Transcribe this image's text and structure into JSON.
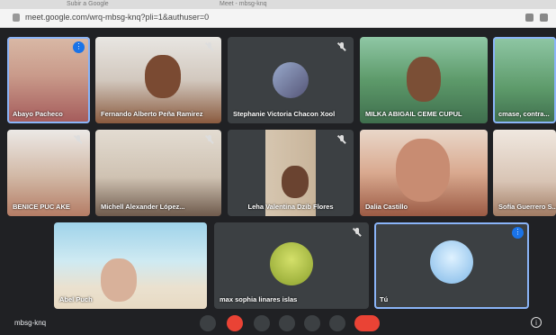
{
  "browser": {
    "tabs": [
      "Subir a Google",
      "Meet - mbsg-knq"
    ],
    "url": "meet.google.com/wrq-mbsg-knq?pli=1&authuser=0"
  },
  "tiles": [
    {
      "name": "Abayo Pacheco",
      "active": true
    },
    {
      "name": "Fernando Alberto Peña Ramirez"
    },
    {
      "name": "Stephanie Victoria Chacon Xool"
    },
    {
      "name": "MILKA ABIGAIL CEME CUPUL"
    },
    {
      "name": "cmase, contra..."
    },
    {
      "name": "BENICE PUC AKE"
    },
    {
      "name": "Michell Alexander López..."
    },
    {
      "name": "Leha Valentina Dzib Flores"
    },
    {
      "name": "Dalia Castillo"
    },
    {
      "name": "Sofía Guerrero S..."
    },
    {
      "name": "Abel Puch"
    },
    {
      "name": "max sophia linares islas"
    },
    {
      "name": "Tú",
      "active": true
    }
  ],
  "meeting_code": "mbsg-knq",
  "controls": [
    "mic-icon",
    "camera-off-icon",
    "captions-icon",
    "raise-hand-icon",
    "present-icon",
    "more-icon",
    "hangup-icon"
  ],
  "colors": {
    "background": "#202124",
    "tile": "#3c4043",
    "accent": "#8ab4f8",
    "hangup": "#ea4335"
  }
}
